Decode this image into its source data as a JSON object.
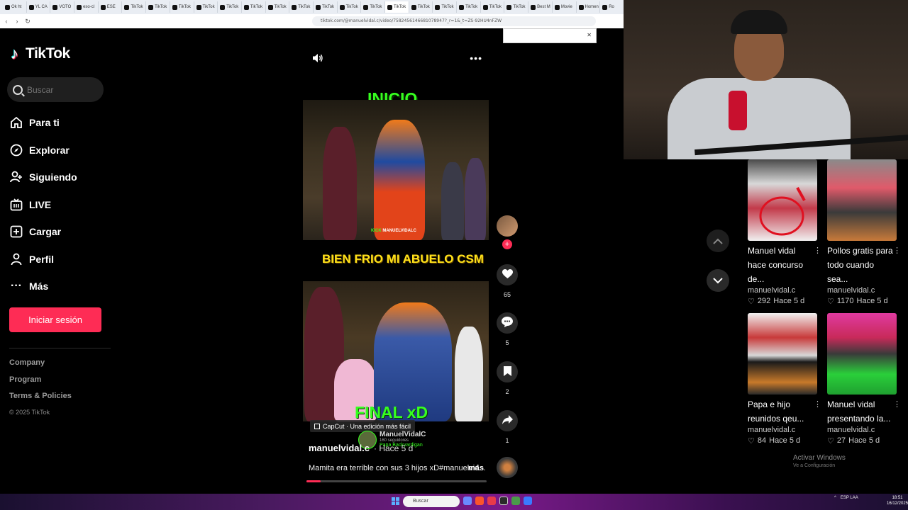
{
  "browser": {
    "tabs": [
      "Ok ht",
      "YL CA",
      "VOTO",
      "eso-cl",
      "ESE",
      "TikTok",
      "TikTok",
      "TikTok",
      "TikTok",
      "TikTok",
      "TikTok",
      "TikTok",
      "TikTok",
      "TikTok",
      "TikTok",
      "TikTok",
      "TikTok",
      "TikTok",
      "TikTok",
      "TikTok",
      "TikTok",
      "TikTok",
      "Best M",
      "Movie",
      "Homen",
      "Ro"
    ],
    "url": "tiktok.com/@manuelvidal.c/video/7582456146681078947?_r=1&_t=ZS-92HU4nFZW"
  },
  "sidebar": {
    "logo": "TikTok",
    "search_placeholder": "Buscar",
    "items": [
      {
        "label": "Para ti",
        "icon": "home-icon"
      },
      {
        "label": "Explorar",
        "icon": "compass-icon"
      },
      {
        "label": "Siguiendo",
        "icon": "following-icon"
      },
      {
        "label": "LIVE",
        "icon": "live-icon"
      },
      {
        "label": "Cargar",
        "icon": "upload-icon"
      },
      {
        "label": "Perfil",
        "icon": "profile-icon"
      },
      {
        "label": "Más",
        "icon": "more-icon"
      }
    ],
    "login": "Iniciar sesión",
    "footer": [
      "Company",
      "Program",
      "Terms & Policies"
    ],
    "copyright": "© 2025 TikTok"
  },
  "video": {
    "caption_top": "INICIO",
    "caption_mid": "BIEN FRIO MI ABUELO CSM",
    "caption_end": "FINAL xD",
    "kick_label": "KICK",
    "kick_channel": "MANUELVIDALC",
    "capcut": "CapCut · Una edición más fácil",
    "author": "manuelvidal.c",
    "ago": "· Hace 5 d",
    "watermark_name": "ManuelVidalC",
    "watermark_sub": "160 seguidores",
    "watermark_song": "Papa Backyardigan",
    "description": "Mamita era terrible con sus 3 hijos xD#manuelvid...",
    "more": "más",
    "progress": 0.08
  },
  "actions": {
    "likes": "65",
    "comments": "5",
    "saves": "2",
    "shares": "1"
  },
  "related": [
    {
      "title": "Manuel vidal hace concurso de...",
      "author": "manuelvidal.c",
      "likes": "292",
      "ago": "Hace 5 d"
    },
    {
      "title": "Pollos gratis para todo cuando sea...",
      "author": "manuelvidal.c",
      "likes": "1170",
      "ago": "Hace 5 d"
    },
    {
      "title": "Papa e hijo reunidos qeu...",
      "author": "manuelvidal.c",
      "likes": "84",
      "ago": "Hace 5 d"
    },
    {
      "title": "Manuel vidal presentando la...",
      "author": "manuelvidal.c",
      "likes": "27",
      "ago": "Hace 5 d"
    }
  ],
  "windows": {
    "activate": "Activar Windows",
    "activate_sub": "Ve a Configuración",
    "search": "Buscar",
    "time": "18:51",
    "date": "16/12/2025",
    "lang": "ESP LAA"
  }
}
